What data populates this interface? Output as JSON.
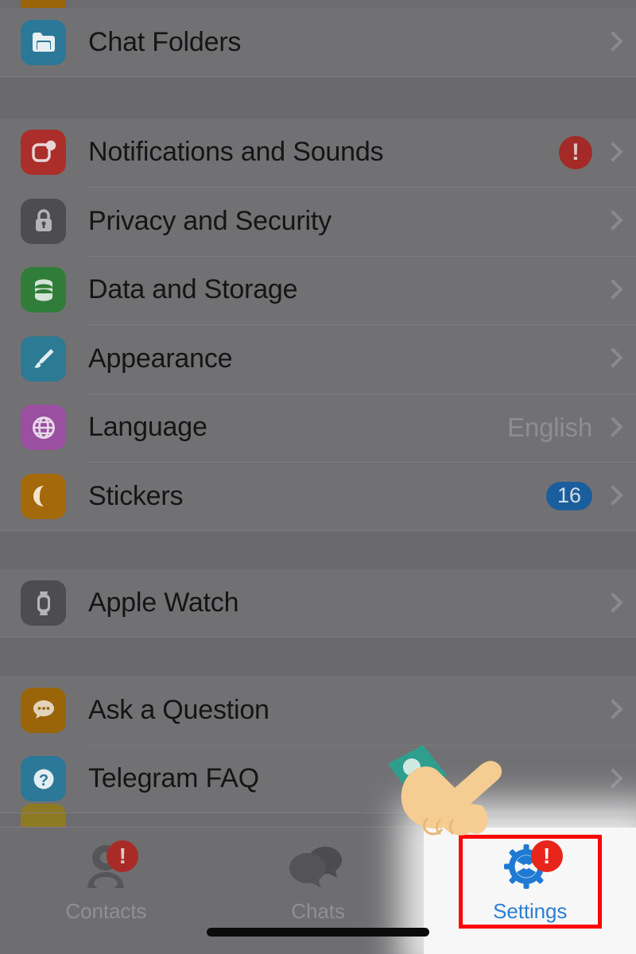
{
  "app": {
    "screen_name": "Telegram Settings"
  },
  "list": {
    "sections": [
      {
        "name": "folders",
        "rows": [
          {
            "label": "Chat Folders",
            "icon": "folder-icon",
            "icon_color": "#2b7899",
            "value": "",
            "badge": "",
            "badge_type": ""
          }
        ]
      },
      {
        "name": "preferences",
        "rows": [
          {
            "label": "Notifications and Sounds",
            "icon": "notifications-icon",
            "icon_color": "#ab2e2b",
            "value": "",
            "badge": "!",
            "badge_type": "warn"
          },
          {
            "label": "Privacy and Security",
            "icon": "lock-icon",
            "icon_color": "#4d4d4f",
            "value": "",
            "badge": "",
            "badge_type": ""
          },
          {
            "label": "Data and Storage",
            "icon": "database-icon",
            "icon_color": "#2f7d39",
            "value": "",
            "badge": "",
            "badge_type": ""
          },
          {
            "label": "Appearance",
            "icon": "paintbrush-icon",
            "icon_color": "#2c7a94",
            "value": "",
            "badge": "",
            "badge_type": ""
          },
          {
            "label": "Language",
            "icon": "globe-icon",
            "icon_color": "#9b4fa0",
            "value": "English",
            "badge": "",
            "badge_type": ""
          },
          {
            "label": "Stickers",
            "icon": "sticker-icon",
            "icon_color": "#a3690a",
            "value": "",
            "badge": "16",
            "badge_type": "count"
          }
        ]
      },
      {
        "name": "devices",
        "rows": [
          {
            "label": "Apple Watch",
            "icon": "apple-watch-icon",
            "icon_color": "#4d4d4f",
            "value": "",
            "badge": "",
            "badge_type": ""
          }
        ]
      },
      {
        "name": "help",
        "rows": [
          {
            "label": "Ask a Question",
            "icon": "chat-bubble-icon",
            "icon_color": "#9a6508",
            "value": "",
            "badge": "",
            "badge_type": ""
          },
          {
            "label": "Telegram FAQ",
            "icon": "question-mark-icon",
            "icon_color": "#2b7899",
            "value": "",
            "badge": "",
            "badge_type": ""
          }
        ]
      }
    ]
  },
  "tabbar": {
    "tabs": [
      {
        "label": "Contacts",
        "icon": "contacts-icon",
        "badge": "!",
        "selected": false
      },
      {
        "label": "Chats",
        "icon": "chats-icon",
        "badge": "",
        "selected": false
      },
      {
        "label": "Settings",
        "icon": "gear-icon",
        "badge": "!",
        "selected": true
      }
    ]
  },
  "annotation": {
    "highlight_color": "#fa0707",
    "cursor": "pointing-hand-cursor"
  }
}
